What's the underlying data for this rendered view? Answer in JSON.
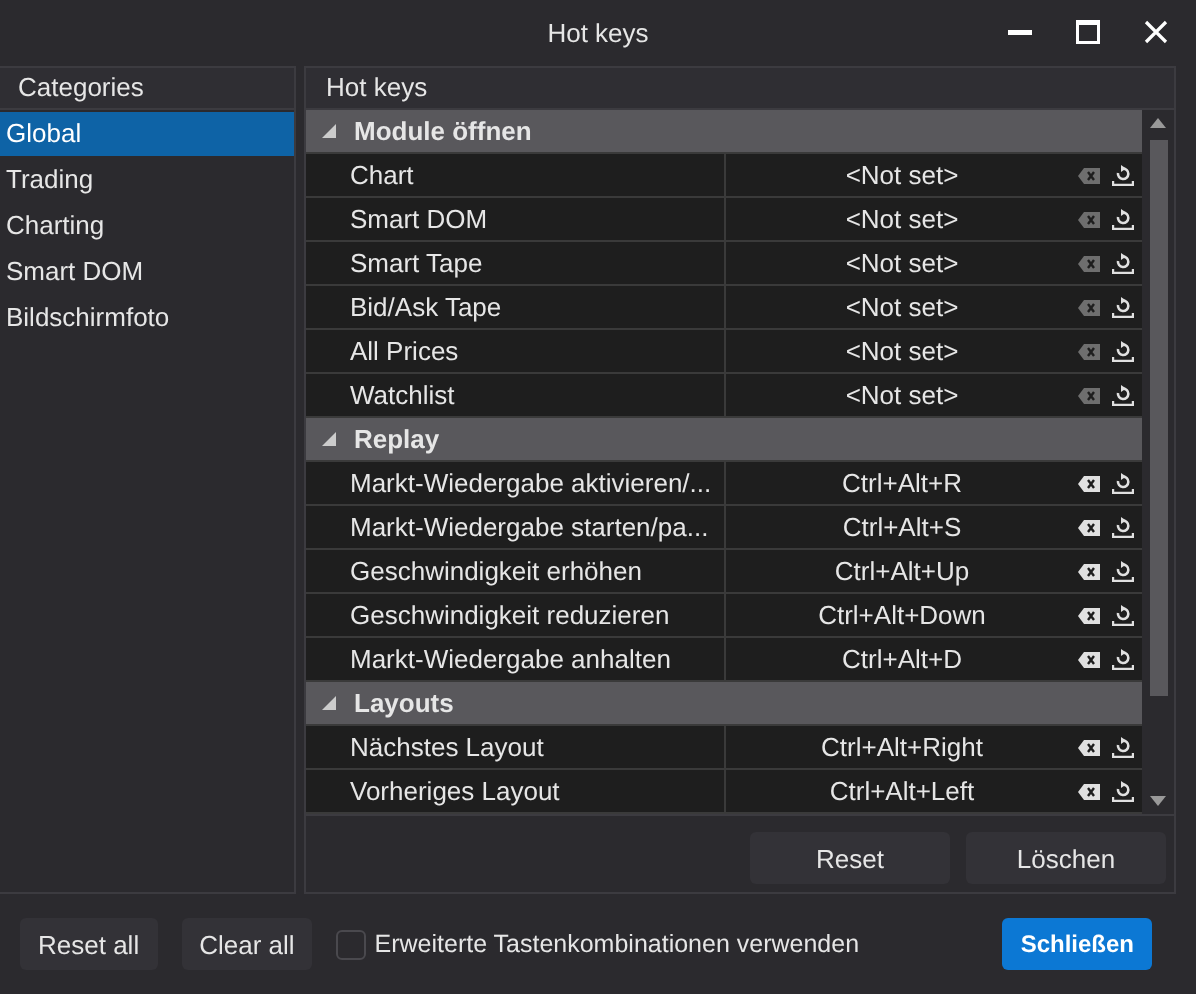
{
  "window": {
    "title": "Hot keys"
  },
  "categories": {
    "header": "Categories",
    "items": [
      {
        "label": "Global",
        "selected": true
      },
      {
        "label": "Trading",
        "selected": false
      },
      {
        "label": "Charting",
        "selected": false
      },
      {
        "label": "Smart DOM",
        "selected": false
      },
      {
        "label": "Bildschirmfoto",
        "selected": false
      }
    ]
  },
  "hotkeys": {
    "header": "Hot keys",
    "groups": [
      {
        "title": "Module öffnen",
        "expanded": true,
        "rows": [
          {
            "name": "Chart",
            "key": "<Not set>",
            "clearable": false
          },
          {
            "name": "Smart DOM",
            "key": "<Not set>",
            "clearable": false
          },
          {
            "name": "Smart Tape",
            "key": "<Not set>",
            "clearable": false
          },
          {
            "name": "Bid/Ask Tape",
            "key": "<Not set>",
            "clearable": false
          },
          {
            "name": "All Prices",
            "key": "<Not set>",
            "clearable": false
          },
          {
            "name": "Watchlist",
            "key": "<Not set>",
            "clearable": false
          }
        ]
      },
      {
        "title": "Replay",
        "expanded": true,
        "rows": [
          {
            "name": "Markt-Wiedergabe aktivieren/...",
            "key": "Ctrl+Alt+R",
            "clearable": true
          },
          {
            "name": "Markt-Wiedergabe starten/pa...",
            "key": "Ctrl+Alt+S",
            "clearable": true
          },
          {
            "name": "Geschwindigkeit erhöhen",
            "key": "Ctrl+Alt+Up",
            "clearable": true
          },
          {
            "name": "Geschwindigkeit reduzieren",
            "key": "Ctrl+Alt+Down",
            "clearable": true
          },
          {
            "name": "Markt-Wiedergabe anhalten",
            "key": "Ctrl+Alt+D",
            "clearable": true
          }
        ]
      },
      {
        "title": "Layouts",
        "expanded": true,
        "rows": [
          {
            "name": "Nächstes Layout",
            "key": "Ctrl+Alt+Right",
            "clearable": true
          },
          {
            "name": "Vorheriges Layout",
            "key": "Ctrl+Alt+Left",
            "clearable": true
          }
        ]
      }
    ],
    "buttons": [
      "Reset",
      "Löschen"
    ]
  },
  "footer": {
    "reset_all": "Reset all",
    "clear_all": "Clear all",
    "checkbox": {
      "label": "Erweiterte Tastenkombinationen verwenden",
      "checked": false
    },
    "close": "Schließen"
  }
}
